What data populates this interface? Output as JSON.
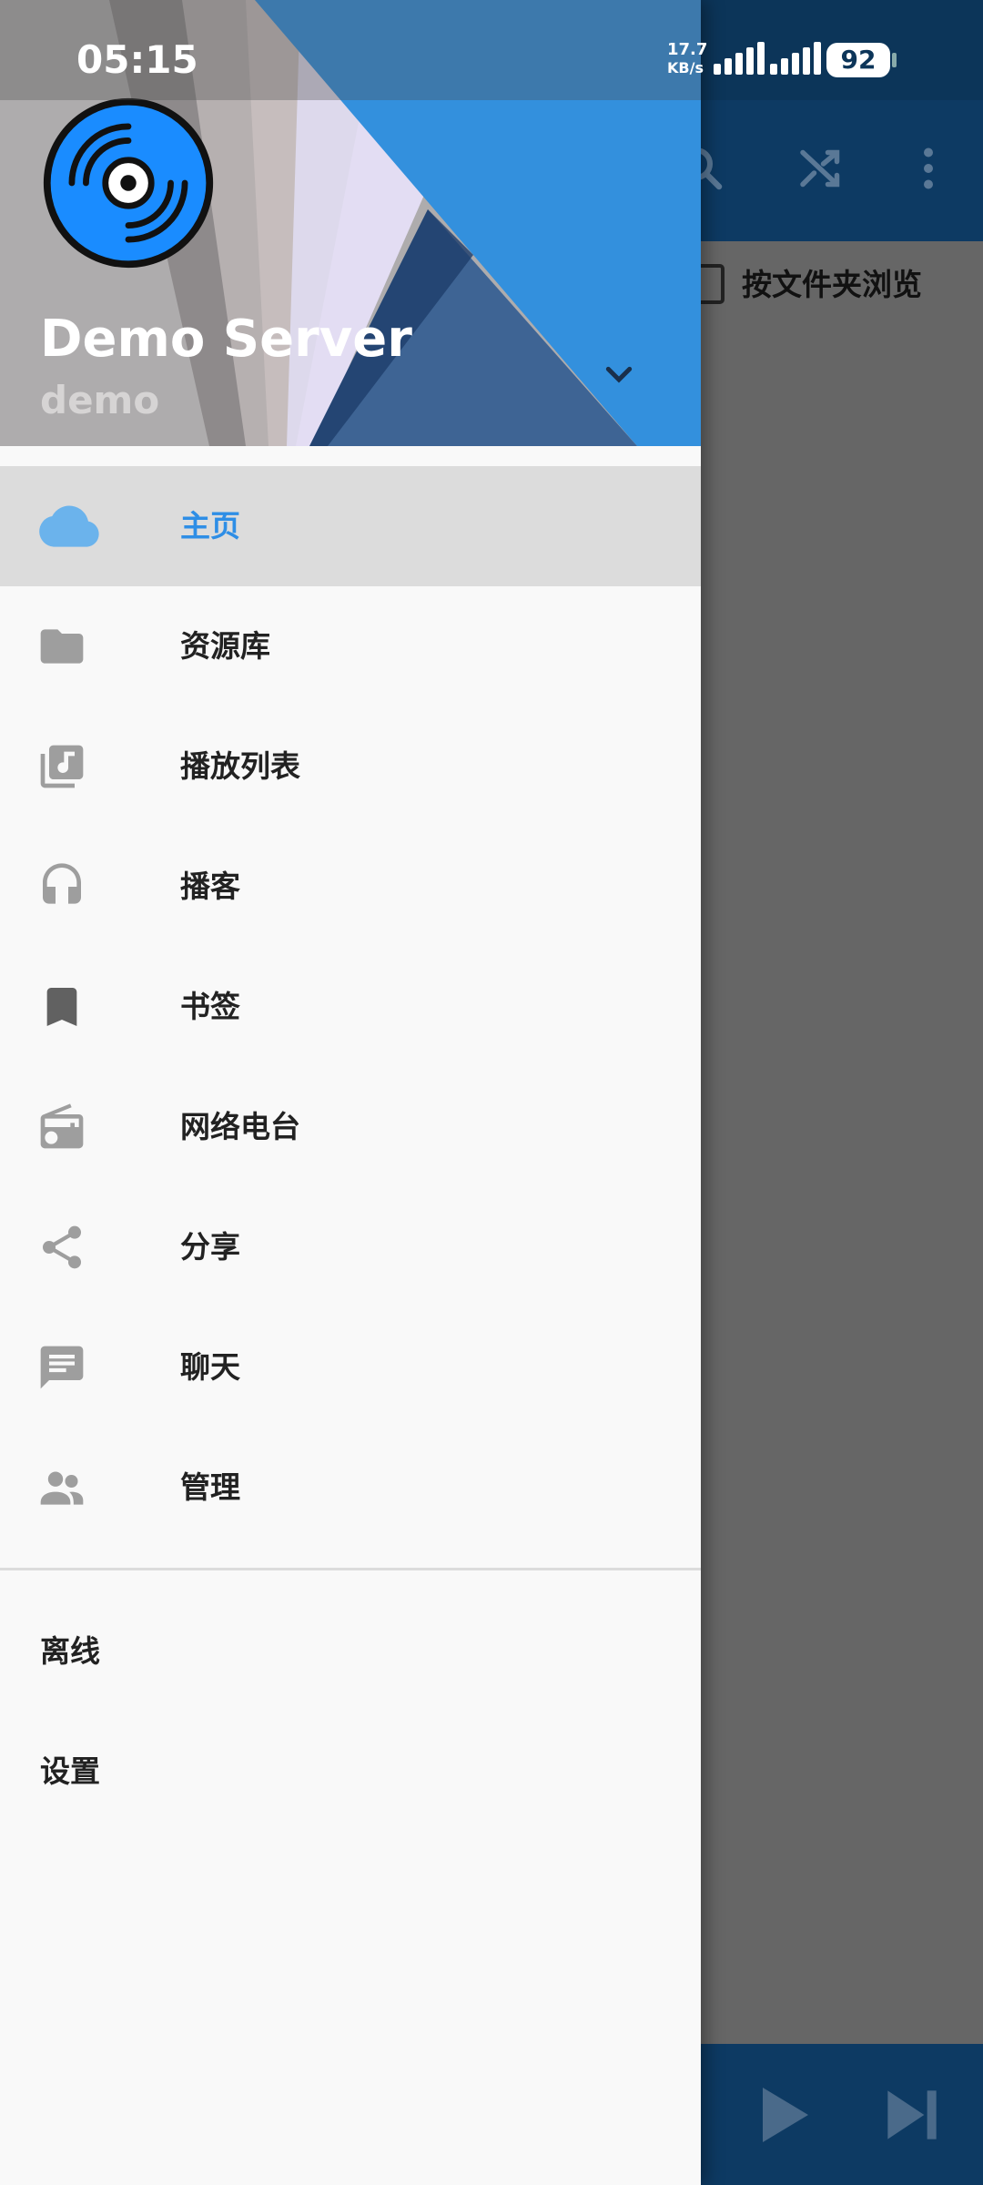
{
  "status_bar": {
    "time": "05:15",
    "net_speed_top": "17.7",
    "net_speed_bottom": "KB/s",
    "battery": "92"
  },
  "background": {
    "folder_toggle_label": "按文件夹浏览",
    "icons": [
      "search-icon",
      "shuffle-icon",
      "more-vert-icon",
      "play-icon",
      "skip-next-icon"
    ]
  },
  "drawer": {
    "server_name": "Demo Server",
    "username": "demo",
    "items": [
      {
        "label": "主页",
        "icon": "cloud-icon",
        "active": true
      },
      {
        "label": "资源库",
        "icon": "folder-icon"
      },
      {
        "label": "播放列表",
        "icon": "playlist-icon"
      },
      {
        "label": "播客",
        "icon": "headphones-icon"
      },
      {
        "label": "书签",
        "icon": "bookmark-icon"
      },
      {
        "label": "网络电台",
        "icon": "radio-icon"
      },
      {
        "label": "分享",
        "icon": "share-icon"
      },
      {
        "label": "聊天",
        "icon": "chat-icon"
      },
      {
        "label": "管理",
        "icon": "people-icon"
      }
    ],
    "secondary_items": [
      {
        "label": "离线"
      },
      {
        "label": "设置"
      }
    ]
  },
  "colors": {
    "accent": "#2e8ee6",
    "appbar": "#0d3a63",
    "icon_gray": "#9e9e9e",
    "header_blue": "#3390dd"
  }
}
